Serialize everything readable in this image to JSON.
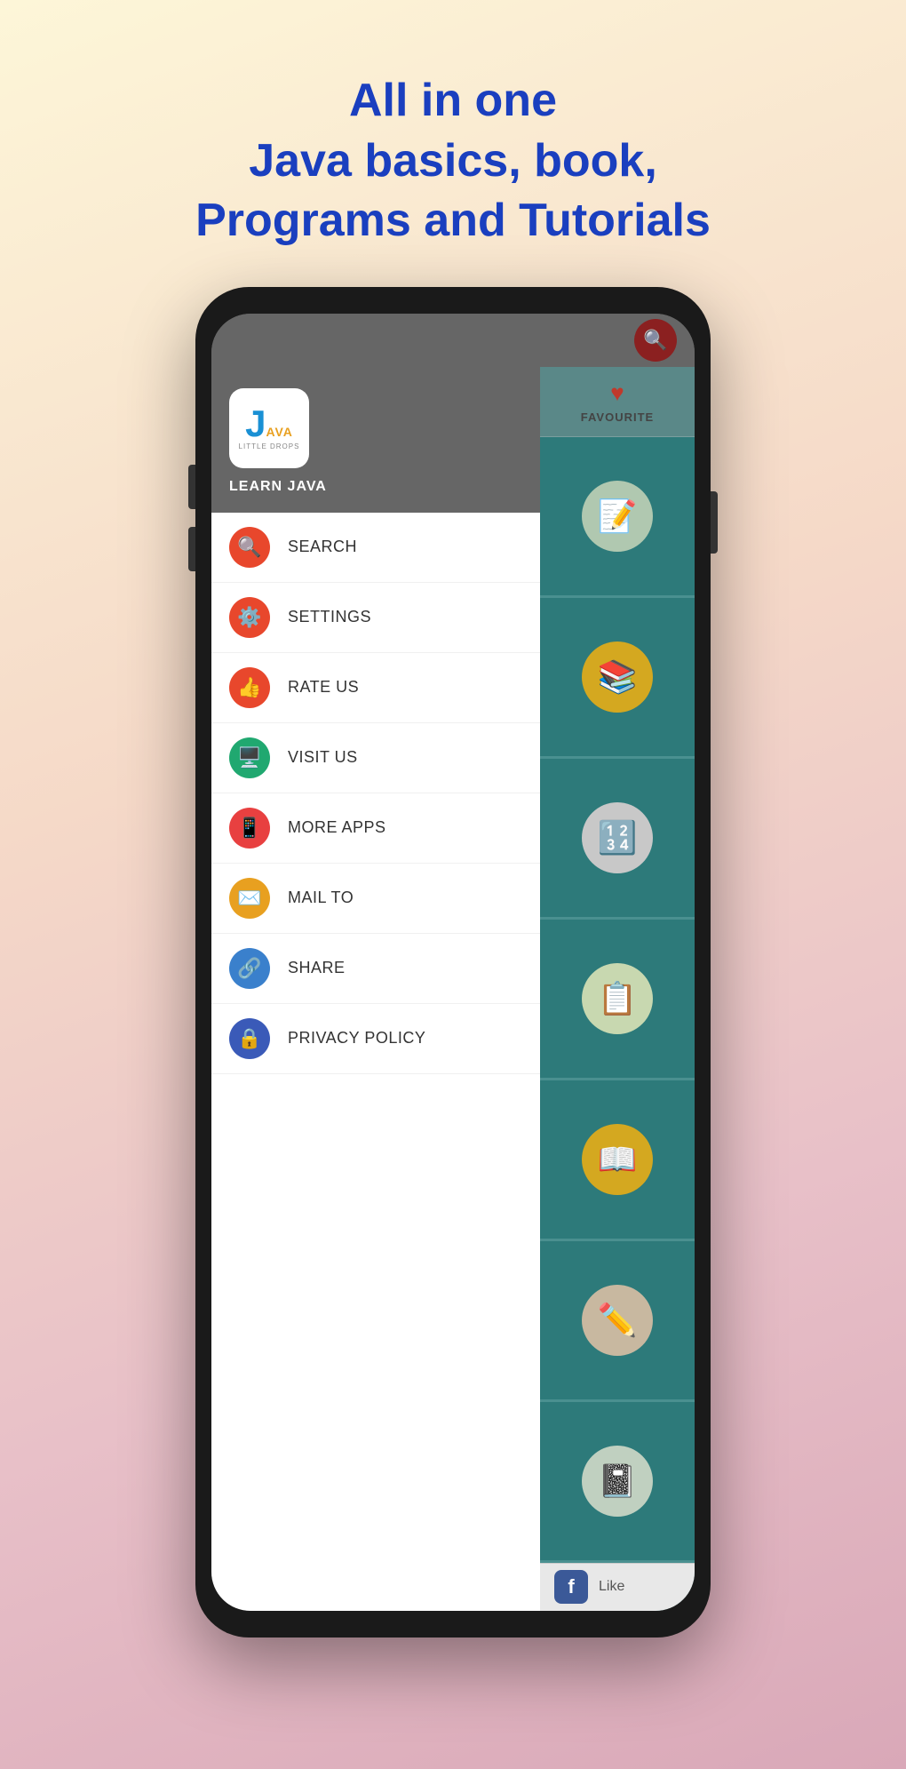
{
  "header": {
    "line1": "All in one",
    "line2": "Java basics, book,",
    "line3": "Programs and Tutorials"
  },
  "app": {
    "logo_j": "J",
    "logo_ava": "AVA",
    "logo_sub": "LITTLE DROPS",
    "name": "LEARN JAVA"
  },
  "favourite": {
    "label": "FAVOURITE"
  },
  "menu": [
    {
      "id": "search",
      "label": "SEARCH",
      "icon": "🔍",
      "icon_class": "icon-search"
    },
    {
      "id": "settings",
      "label": "SETTINGS",
      "icon": "⚙️",
      "icon_class": "icon-settings"
    },
    {
      "id": "rate",
      "label": "RATE US",
      "icon": "👍",
      "icon_class": "icon-rate"
    },
    {
      "id": "visit",
      "label": "VISIT US",
      "icon": "🖥️",
      "icon_class": "icon-visit"
    },
    {
      "id": "more",
      "label": "MORE APPS",
      "icon": "📱",
      "icon_class": "icon-more"
    },
    {
      "id": "mail",
      "label": "MAIL TO",
      "icon": "✉️",
      "icon_class": "icon-mail"
    },
    {
      "id": "share",
      "label": "SHARE",
      "icon": "🔗",
      "icon_class": "icon-share"
    },
    {
      "id": "privacy",
      "label": "PRIVACY POLICY",
      "icon": "🔒",
      "icon_class": "icon-privacy"
    }
  ],
  "tiles": [
    {
      "id": "tile1",
      "icon": "📝",
      "icon_class": "tile-icon-1"
    },
    {
      "id": "tile2",
      "icon": "📚",
      "icon_class": "tile-icon-2"
    },
    {
      "id": "tile3",
      "icon": "🔢",
      "icon_class": "tile-icon-3"
    },
    {
      "id": "tile4",
      "icon": "📋",
      "icon_class": "tile-icon-4"
    },
    {
      "id": "tile5",
      "icon": "📖",
      "icon_class": "tile-icon-5"
    },
    {
      "id": "tile6",
      "icon": "✏️",
      "icon_class": "tile-icon-6"
    },
    {
      "id": "tile7",
      "icon": "📓",
      "icon_class": "tile-icon-7"
    }
  ],
  "bottom_bar": {
    "fb_letter": "f",
    "like_text": "Like"
  }
}
